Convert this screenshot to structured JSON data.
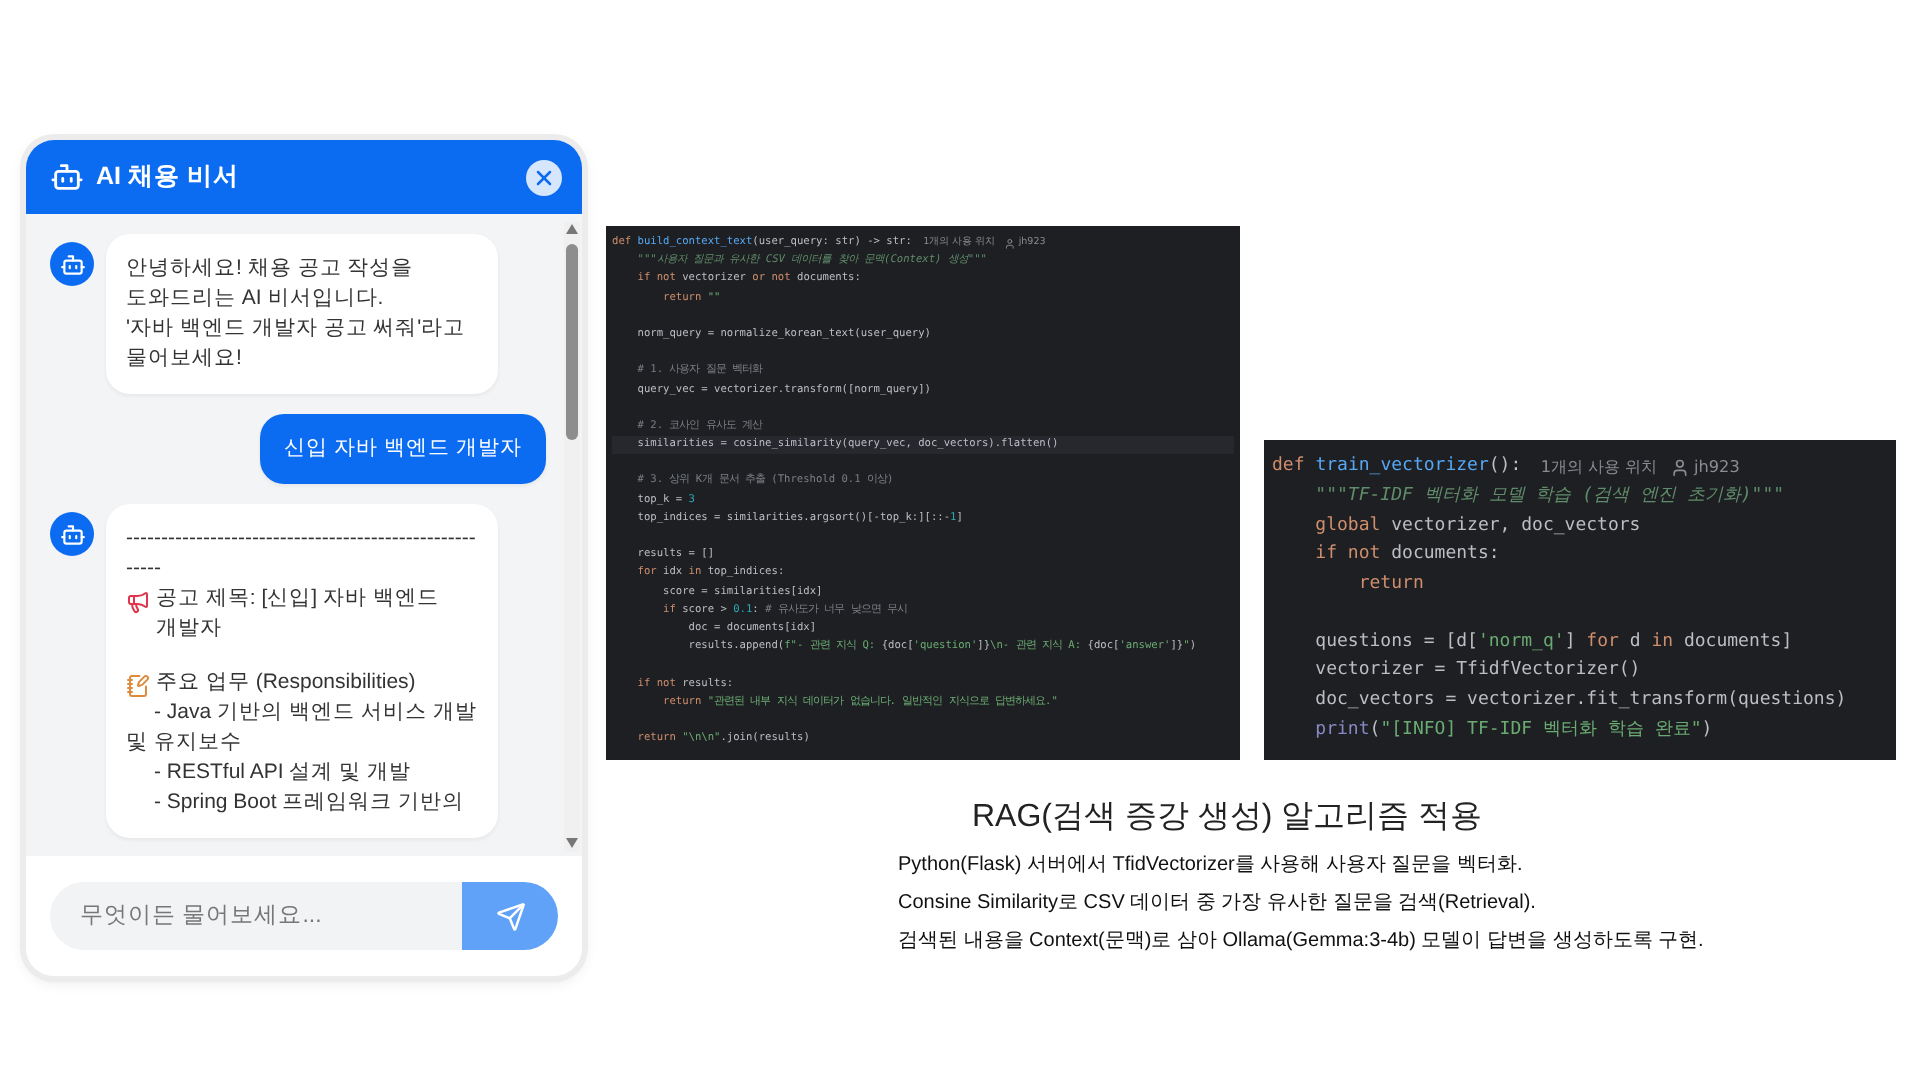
{
  "chat": {
    "title": "AI 채용 비서",
    "messages": [
      {
        "kind": "bot",
        "blocks": [
          {
            "kind": "text",
            "text": "안녕하세요! 채용 공고 작성을 도와드리는 AI 비서입니다.\n'자바 백엔드 개발자 공고 써줘'라고 물어보세요!"
          }
        ]
      },
      {
        "kind": "user",
        "blocks": [
          {
            "kind": "text",
            "text": "신입 자바 백엔드 개발자"
          }
        ]
      },
      {
        "kind": "bot",
        "blocks": [
          {
            "kind": "rule",
            "text": "-------------------------------------------------------"
          },
          {
            "kind": "title",
            "text": "공고 제목: [신입] 자바 백엔드 개발자"
          },
          {
            "kind": "section",
            "text": "주요 업무 (Responsibilities)"
          },
          {
            "kind": "bullet",
            "text": "- Java 기반의 백엔드 서비스 개발 및 유지보수"
          },
          {
            "kind": "bullet",
            "text": "- RESTful API 설계 및 개발"
          },
          {
            "kind": "bullet",
            "text": "- Spring Boot 프레임워크 기반의"
          }
        ]
      }
    ],
    "input": {
      "placeholder": "무엇이든 물어보세요..."
    }
  },
  "code_panels": [
    {
      "lines": [
        {
          "kind": "code",
          "current": false,
          "usages": "1개의 사용 위치",
          "author": "jh923",
          "tokens": [
            {
              "kind": "kw",
              "text": "def "
            },
            {
              "kind": "fn",
              "text": "build_context_text"
            },
            {
              "kind": "txt",
              "text": "(user_query: str) -> str:"
            }
          ]
        },
        {
          "kind": "code",
          "current": false,
          "tokens": [
            {
              "kind": "doc",
              "text": "    \"\"\"사용자 질문과 유사한 CSV 데이터를 찾아 문맥(Context) 생성\"\"\""
            }
          ]
        },
        {
          "kind": "code",
          "current": false,
          "tokens": [
            {
              "kind": "kw",
              "text": "    if not"
            },
            {
              "kind": "txt",
              "text": " vectorizer "
            },
            {
              "kind": "kw",
              "text": "or not"
            },
            {
              "kind": "txt",
              "text": " documents:"
            }
          ]
        },
        {
          "kind": "code",
          "current": false,
          "tokens": [
            {
              "kind": "kw",
              "text": "        return "
            },
            {
              "kind": "str",
              "text": "\"\""
            }
          ]
        },
        {
          "kind": "blank"
        },
        {
          "kind": "code",
          "current": false,
          "tokens": [
            {
              "kind": "txt",
              "text": "    norm_query = normalize_korean_text(user_query)"
            }
          ]
        },
        {
          "kind": "blank"
        },
        {
          "kind": "code",
          "current": false,
          "tokens": [
            {
              "kind": "cmt",
              "text": "    # 1. 사용자 질문 벡터화"
            }
          ]
        },
        {
          "kind": "code",
          "current": false,
          "tokens": [
            {
              "kind": "txt",
              "text": "    query_vec = vectorizer.transform([norm_query])"
            }
          ]
        },
        {
          "kind": "blank"
        },
        {
          "kind": "code",
          "current": false,
          "tokens": [
            {
              "kind": "cmt",
              "text": "    # 2. 코사인 유사도 계산"
            }
          ]
        },
        {
          "kind": "code",
          "current": true,
          "tokens": [
            {
              "kind": "txt",
              "text": "    similarities = cosine_similarity(query_vec, doc_vectors).flatten()"
            }
          ]
        },
        {
          "kind": "blank"
        },
        {
          "kind": "code",
          "current": false,
          "tokens": [
            {
              "kind": "cmt",
              "text": "    # 3. 상위 K개 문서 추출 (Threshold 0.1 이상)"
            }
          ]
        },
        {
          "kind": "code",
          "current": false,
          "tokens": [
            {
              "kind": "txt",
              "text": "    top_k = "
            },
            {
              "kind": "num",
              "text": "3"
            }
          ]
        },
        {
          "kind": "code",
          "current": false,
          "tokens": [
            {
              "kind": "txt",
              "text": "    top_indices = similarities.argsort()[-top_k:][::-"
            },
            {
              "kind": "num",
              "text": "1"
            },
            {
              "kind": "txt",
              "text": "]"
            }
          ]
        },
        {
          "kind": "blank"
        },
        {
          "kind": "code",
          "current": false,
          "tokens": [
            {
              "kind": "txt",
              "text": "    results = []"
            }
          ]
        },
        {
          "kind": "code",
          "current": false,
          "tokens": [
            {
              "kind": "kw",
              "text": "    for"
            },
            {
              "kind": "txt",
              "text": " idx "
            },
            {
              "kind": "kw",
              "text": "in"
            },
            {
              "kind": "txt",
              "text": " top_indices:"
            }
          ]
        },
        {
          "kind": "code",
          "current": false,
          "tokens": [
            {
              "kind": "txt",
              "text": "        score = similarities[idx]"
            }
          ]
        },
        {
          "kind": "code",
          "current": false,
          "tokens": [
            {
              "kind": "kw",
              "text": "        if"
            },
            {
              "kind": "txt",
              "text": " score > "
            },
            {
              "kind": "num",
              "text": "0.1"
            },
            {
              "kind": "txt",
              "text": ": "
            },
            {
              "kind": "cmt",
              "text": "# 유사도가 너무 낮으면 무시"
            }
          ]
        },
        {
          "kind": "code",
          "current": false,
          "tokens": [
            {
              "kind": "txt",
              "text": "            doc = documents[idx]"
            }
          ]
        },
        {
          "kind": "code",
          "current": false,
          "tokens": [
            {
              "kind": "txt",
              "text": "            results.append("
            },
            {
              "kind": "str",
              "text": "f\"- 관련 지식 Q: "
            },
            {
              "kind": "txt",
              "text": "{doc["
            },
            {
              "kind": "str",
              "text": "'question'"
            },
            {
              "kind": "txt",
              "text": "]}"
            },
            {
              "kind": "str",
              "text": "\\n- 관련 지식 A: "
            },
            {
              "kind": "txt",
              "text": "{doc["
            },
            {
              "kind": "str",
              "text": "'answer'"
            },
            {
              "kind": "txt",
              "text": "]}"
            },
            {
              "kind": "str",
              "text": "\""
            },
            {
              "kind": "txt",
              "text": ")"
            }
          ]
        },
        {
          "kind": "blank"
        },
        {
          "kind": "code",
          "current": false,
          "tokens": [
            {
              "kind": "kw",
              "text": "    if not"
            },
            {
              "kind": "txt",
              "text": " results:"
            }
          ]
        },
        {
          "kind": "code",
          "current": false,
          "tokens": [
            {
              "kind": "kw",
              "text": "        return "
            },
            {
              "kind": "str",
              "text": "\"관련된 내부 지식 데이터가 없습니다. 일반적인 지식으로 답변하세요.\""
            }
          ]
        },
        {
          "kind": "blank"
        },
        {
          "kind": "code",
          "current": false,
          "tokens": [
            {
              "kind": "kw",
              "text": "    return "
            },
            {
              "kind": "str",
              "text": "\"\\n\\n\""
            },
            {
              "kind": "txt",
              "text": ".join(results)"
            }
          ]
        }
      ]
    },
    {
      "lines": [
        {
          "kind": "code",
          "current": false,
          "usages": "1개의 사용 위치",
          "author": "jh923",
          "tokens": [
            {
              "kind": "kw",
              "text": "def "
            },
            {
              "kind": "fn",
              "text": "train_vectorizer"
            },
            {
              "kind": "txt",
              "text": "():"
            }
          ]
        },
        {
          "kind": "code",
          "current": false,
          "tokens": [
            {
              "kind": "doc",
              "text": "    \"\"\"TF-IDF 벡터화 모델 학습 (검색 엔진 초기화)\"\"\""
            }
          ]
        },
        {
          "kind": "code",
          "current": false,
          "tokens": [
            {
              "kind": "kw",
              "text": "    global"
            },
            {
              "kind": "txt",
              "text": " vectorizer, doc_vectors"
            }
          ]
        },
        {
          "kind": "code",
          "current": false,
          "tokens": [
            {
              "kind": "kw",
              "text": "    if not"
            },
            {
              "kind": "txt",
              "text": " documents:"
            }
          ]
        },
        {
          "kind": "code",
          "current": false,
          "tokens": [
            {
              "kind": "kw",
              "text": "        return"
            }
          ]
        },
        {
          "kind": "blank"
        },
        {
          "kind": "code",
          "current": false,
          "tokens": [
            {
              "kind": "txt",
              "text": "    questions = [d["
            },
            {
              "kind": "str",
              "text": "'norm_q'"
            },
            {
              "kind": "txt",
              "text": "] "
            },
            {
              "kind": "kw",
              "text": "for"
            },
            {
              "kind": "txt",
              "text": " d "
            },
            {
              "kind": "kw",
              "text": "in"
            },
            {
              "kind": "txt",
              "text": " documents]"
            }
          ]
        },
        {
          "kind": "code",
          "current": false,
          "tokens": [
            {
              "kind": "txt",
              "text": "    vectorizer = TfidfVectorizer()"
            }
          ]
        },
        {
          "kind": "code",
          "current": false,
          "tokens": [
            {
              "kind": "txt",
              "text": "    doc_vectors = vectorizer.fit_transform(questions)"
            }
          ]
        },
        {
          "kind": "code",
          "current": false,
          "tokens": [
            {
              "kind": "builtin",
              "text": "    print"
            },
            {
              "kind": "txt",
              "text": "("
            },
            {
              "kind": "str",
              "text": "\"[INFO] TF-IDF 벡터화 학습 완료\""
            },
            {
              "kind": "txt",
              "text": ")"
            }
          ]
        }
      ]
    }
  ],
  "slide": {
    "heading": "RAG(검색 증강 생성) 알고리즘 적용",
    "lines": [
      "Python(Flask) 서버에서 TfidVectorizer를 사용해 사용자 질문을 벡터화.",
      "Consine Similarity로 CSV 데이터 중 가장 유사한 질문을 검색(Retrieval).",
      "검색된 내용을 Context(문맥)로 삼아 Ollama(Gemma:3-4b) 모델이 답변을 생성하도록 구현."
    ]
  }
}
